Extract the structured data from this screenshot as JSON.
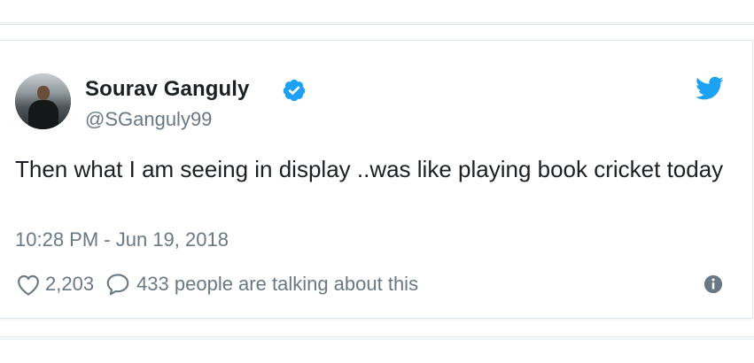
{
  "tweet": {
    "author_name": "Sourav Ganguly",
    "author_handle": "@SGanguly99",
    "text": "Then what I am seeing in display ..was like playing book cricket today",
    "timestamp": "10:28 PM - Jun 19, 2018",
    "likes": "2,203",
    "talking": "433 people are talking about this"
  },
  "icons": {
    "verified": "verified-badge-icon",
    "platform": "twitter-bird-icon",
    "like": "heart-icon",
    "reply": "reply-bubble-icon",
    "info": "info-icon"
  },
  "colors": {
    "brand": "#1da1f2",
    "text": "#1c2022",
    "muted": "#697882",
    "border": "#e1e8ed"
  }
}
